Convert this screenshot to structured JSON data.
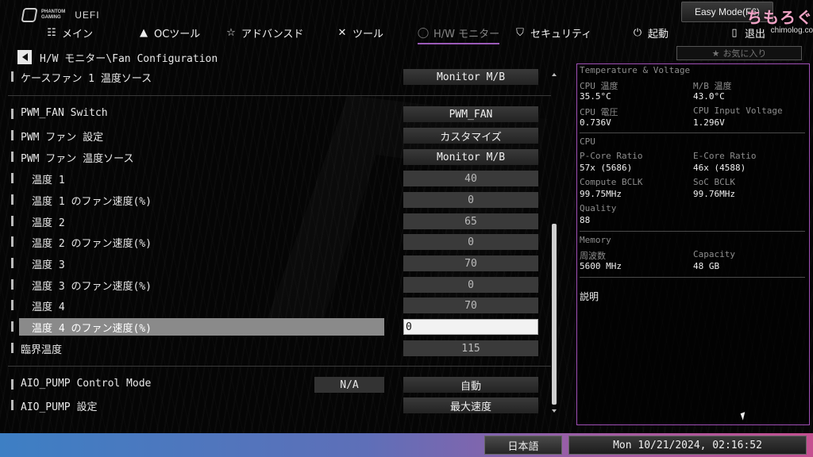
{
  "header": {
    "brand_line1": "PHANTOM",
    "brand_line2": "GAMING",
    "brand_uefi": "UEFI",
    "easy_mode": "Easy Mode(F6)",
    "watermark_title": "ちもろぐ",
    "watermark_url": "chimolog.co"
  },
  "nav": {
    "items": [
      {
        "label": "メイン",
        "icon": "grid-icon"
      },
      {
        "label": "OCツール",
        "icon": "rocket-icon"
      },
      {
        "label": "アドバンスド",
        "icon": "star-icon"
      },
      {
        "label": "ツール",
        "icon": "tools-icon"
      },
      {
        "label": "H/W モニター",
        "icon": "monitor-icon"
      },
      {
        "label": "セキュリティ",
        "icon": "shield-icon"
      },
      {
        "label": "起動",
        "icon": "power-icon"
      },
      {
        "label": "退出",
        "icon": "exit-icon"
      }
    ],
    "favorites": "お気に入り"
  },
  "breadcrumb": "H/W モニター\\Fan Configuration",
  "settings": [
    {
      "label": "ケースファン 1 温度ソース",
      "value": "Monitor M/B"
    },
    {
      "label": "PWM_FAN Switch",
      "value": "PWM_FAN"
    },
    {
      "label": "PWM ファン 設定",
      "value": "カスタマイズ"
    },
    {
      "label": "PWM ファン 温度ソース",
      "value": "Monitor M/B"
    },
    {
      "label": "温度 1",
      "value": "40"
    },
    {
      "label": "温度 1 のファン速度(%)",
      "value": "0"
    },
    {
      "label": "温度 2",
      "value": "65"
    },
    {
      "label": "温度 2 のファン速度(%)",
      "value": "0"
    },
    {
      "label": "温度 3",
      "value": "70"
    },
    {
      "label": "温度 3 のファン速度(%)",
      "value": "0"
    },
    {
      "label": "温度 4",
      "value": "70"
    },
    {
      "label": "温度 4 のファン速度(%)",
      "value": "0"
    },
    {
      "label": "臨界温度",
      "value": "115"
    },
    {
      "label": "AIO_PUMP Control Mode",
      "na": "N/A",
      "value": "自動"
    },
    {
      "label": "AIO_PUMP 設定",
      "value": "最大速度"
    }
  ],
  "panel": {
    "tv_head": "Temperature & Voltage",
    "cpu_temp_label": "CPU 温度",
    "cpu_temp": "35.5°C",
    "mb_temp_label": "M/B 温度",
    "mb_temp": "43.0°C",
    "cpu_volt_label": "CPU 電圧",
    "cpu_volt": "0.736V",
    "cpu_in_label": "CPU Input Voltage",
    "cpu_in": "1.296V",
    "cpu_head": "CPU",
    "pcore_label": "P-Core Ratio",
    "pcore": "57x (5686)",
    "ecore_label": "E-Core Ratio",
    "ecore": "46x (4588)",
    "cbclk_label": "Compute BCLK",
    "cbclk": "99.75MHz",
    "sbclk_label": "SoC BCLK",
    "sbclk": "99.76MHz",
    "quality_label": "Quality",
    "quality": "88",
    "mem_head": "Memory",
    "freq_label": "周波数",
    "freq": "5600 MHz",
    "cap_label": "Capacity",
    "cap": "48 GB",
    "desc_head": "説明"
  },
  "footer": {
    "language": "日本語",
    "datetime": "Mon 10/21/2024, 02:16:52"
  },
  "colors": {
    "accent_purple": "#a04fb6",
    "bottom_bar_left": "#3d7fc4",
    "bottom_bar_right": "#c45090",
    "highlight_row": "#8a8a8a"
  }
}
